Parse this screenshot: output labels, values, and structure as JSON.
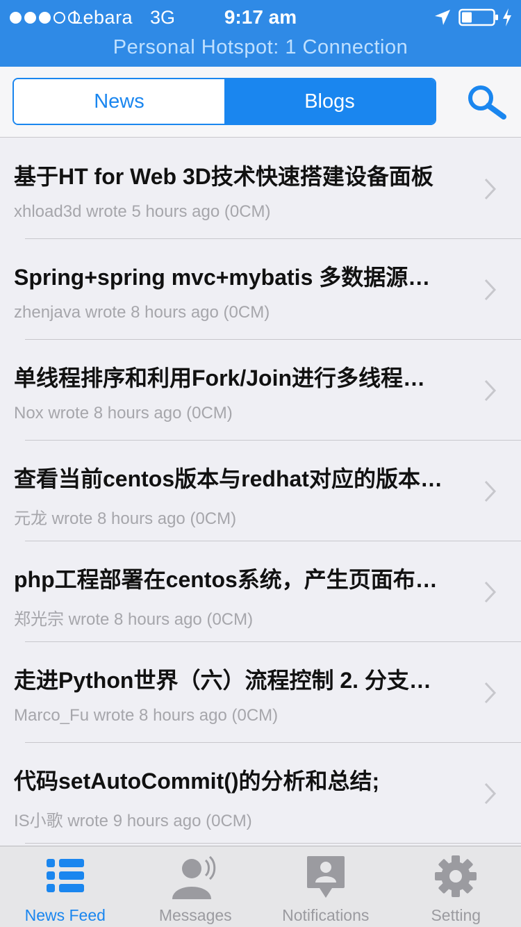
{
  "status_bar": {
    "carrier": "Lebara",
    "network": "3G",
    "time": "9:17 am",
    "signal_strength_bars": 3,
    "signal_total_bars": 5
  },
  "hotspot_banner": "Personal Hotspot: 1 Connection",
  "segments": {
    "news_label": "News",
    "blogs_label": "Blogs",
    "selected": "Blogs"
  },
  "feed": {
    "items": [
      {
        "title": "基于HT for Web 3D技术快速搭建设备面板",
        "meta": "xhload3d wrote 5 hours ago (0CM)"
      },
      {
        "title": "Spring+spring mvc+mybatis 多数据源…",
        "meta": "zhenjava wrote 8 hours ago (0CM)"
      },
      {
        "title": "单线程排序和利用Fork/Join进行多线程…",
        "meta": "Nox wrote 8 hours ago (0CM)"
      },
      {
        "title": "查看当前centos版本与redhat对应的版本…",
        "meta": "元龙 wrote 8 hours ago (0CM)"
      },
      {
        "title": "php工程部署在centos系统，产生页面布…",
        "meta": "郑光宗 wrote 8 hours ago (0CM)"
      },
      {
        "title": "走进Python世界（六）流程控制 2. 分支…",
        "meta": "Marco_Fu wrote 8 hours ago (0CM)"
      },
      {
        "title": "代码setAutoCommit()的分析和总结;",
        "meta": "IS小歌 wrote 9 hours ago (0CM)"
      }
    ]
  },
  "tabbar": {
    "tabs": [
      {
        "label": "News Feed",
        "icon": "list-icon",
        "active": true
      },
      {
        "label": "Messages",
        "icon": "person-speaking-icon",
        "active": false
      },
      {
        "label": "Notifications",
        "icon": "notification-badge-icon",
        "active": false
      },
      {
        "label": "Setting",
        "icon": "gear-icon",
        "active": false
      }
    ]
  },
  "colors": {
    "accent": "#1a86ef",
    "status_bar_bg": "#2f8ae6",
    "inactive_tab": "#9b9ba0"
  }
}
